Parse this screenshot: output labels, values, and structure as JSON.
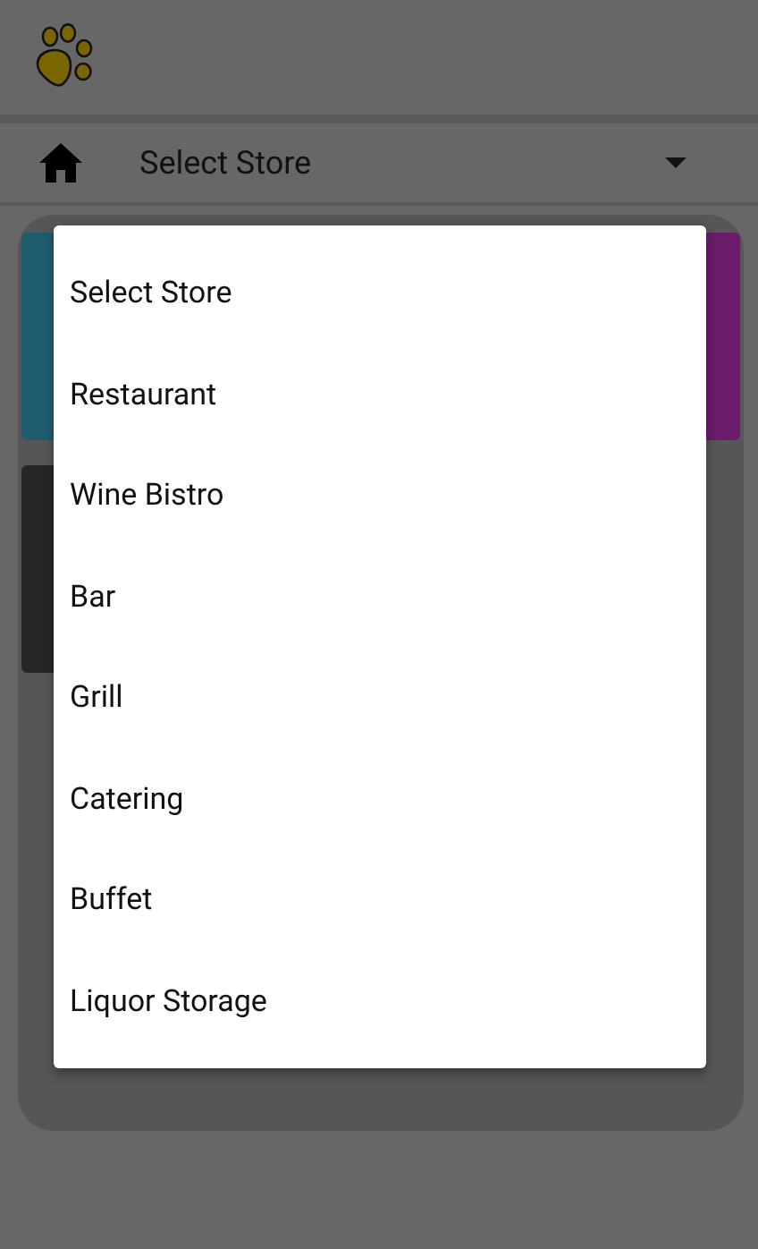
{
  "toolbar": {
    "store_select": {
      "value": "Select Store"
    }
  },
  "tiles": [
    {
      "color": "#1f5d6e"
    },
    {
      "color": "#6a1c6a"
    },
    {
      "color": "#262626"
    }
  ],
  "menu": {
    "options": [
      {
        "label": "Select Store",
        "selected": false
      },
      {
        "label": "Restaurant",
        "selected": false
      },
      {
        "label": "Wine Bistro",
        "selected": false
      },
      {
        "label": "Bar",
        "selected": false
      },
      {
        "label": "Grill",
        "selected": false
      },
      {
        "label": "Catering",
        "selected": false
      },
      {
        "label": "Buffet",
        "selected": false
      },
      {
        "label": "Liquor Storage",
        "selected": false
      }
    ]
  }
}
